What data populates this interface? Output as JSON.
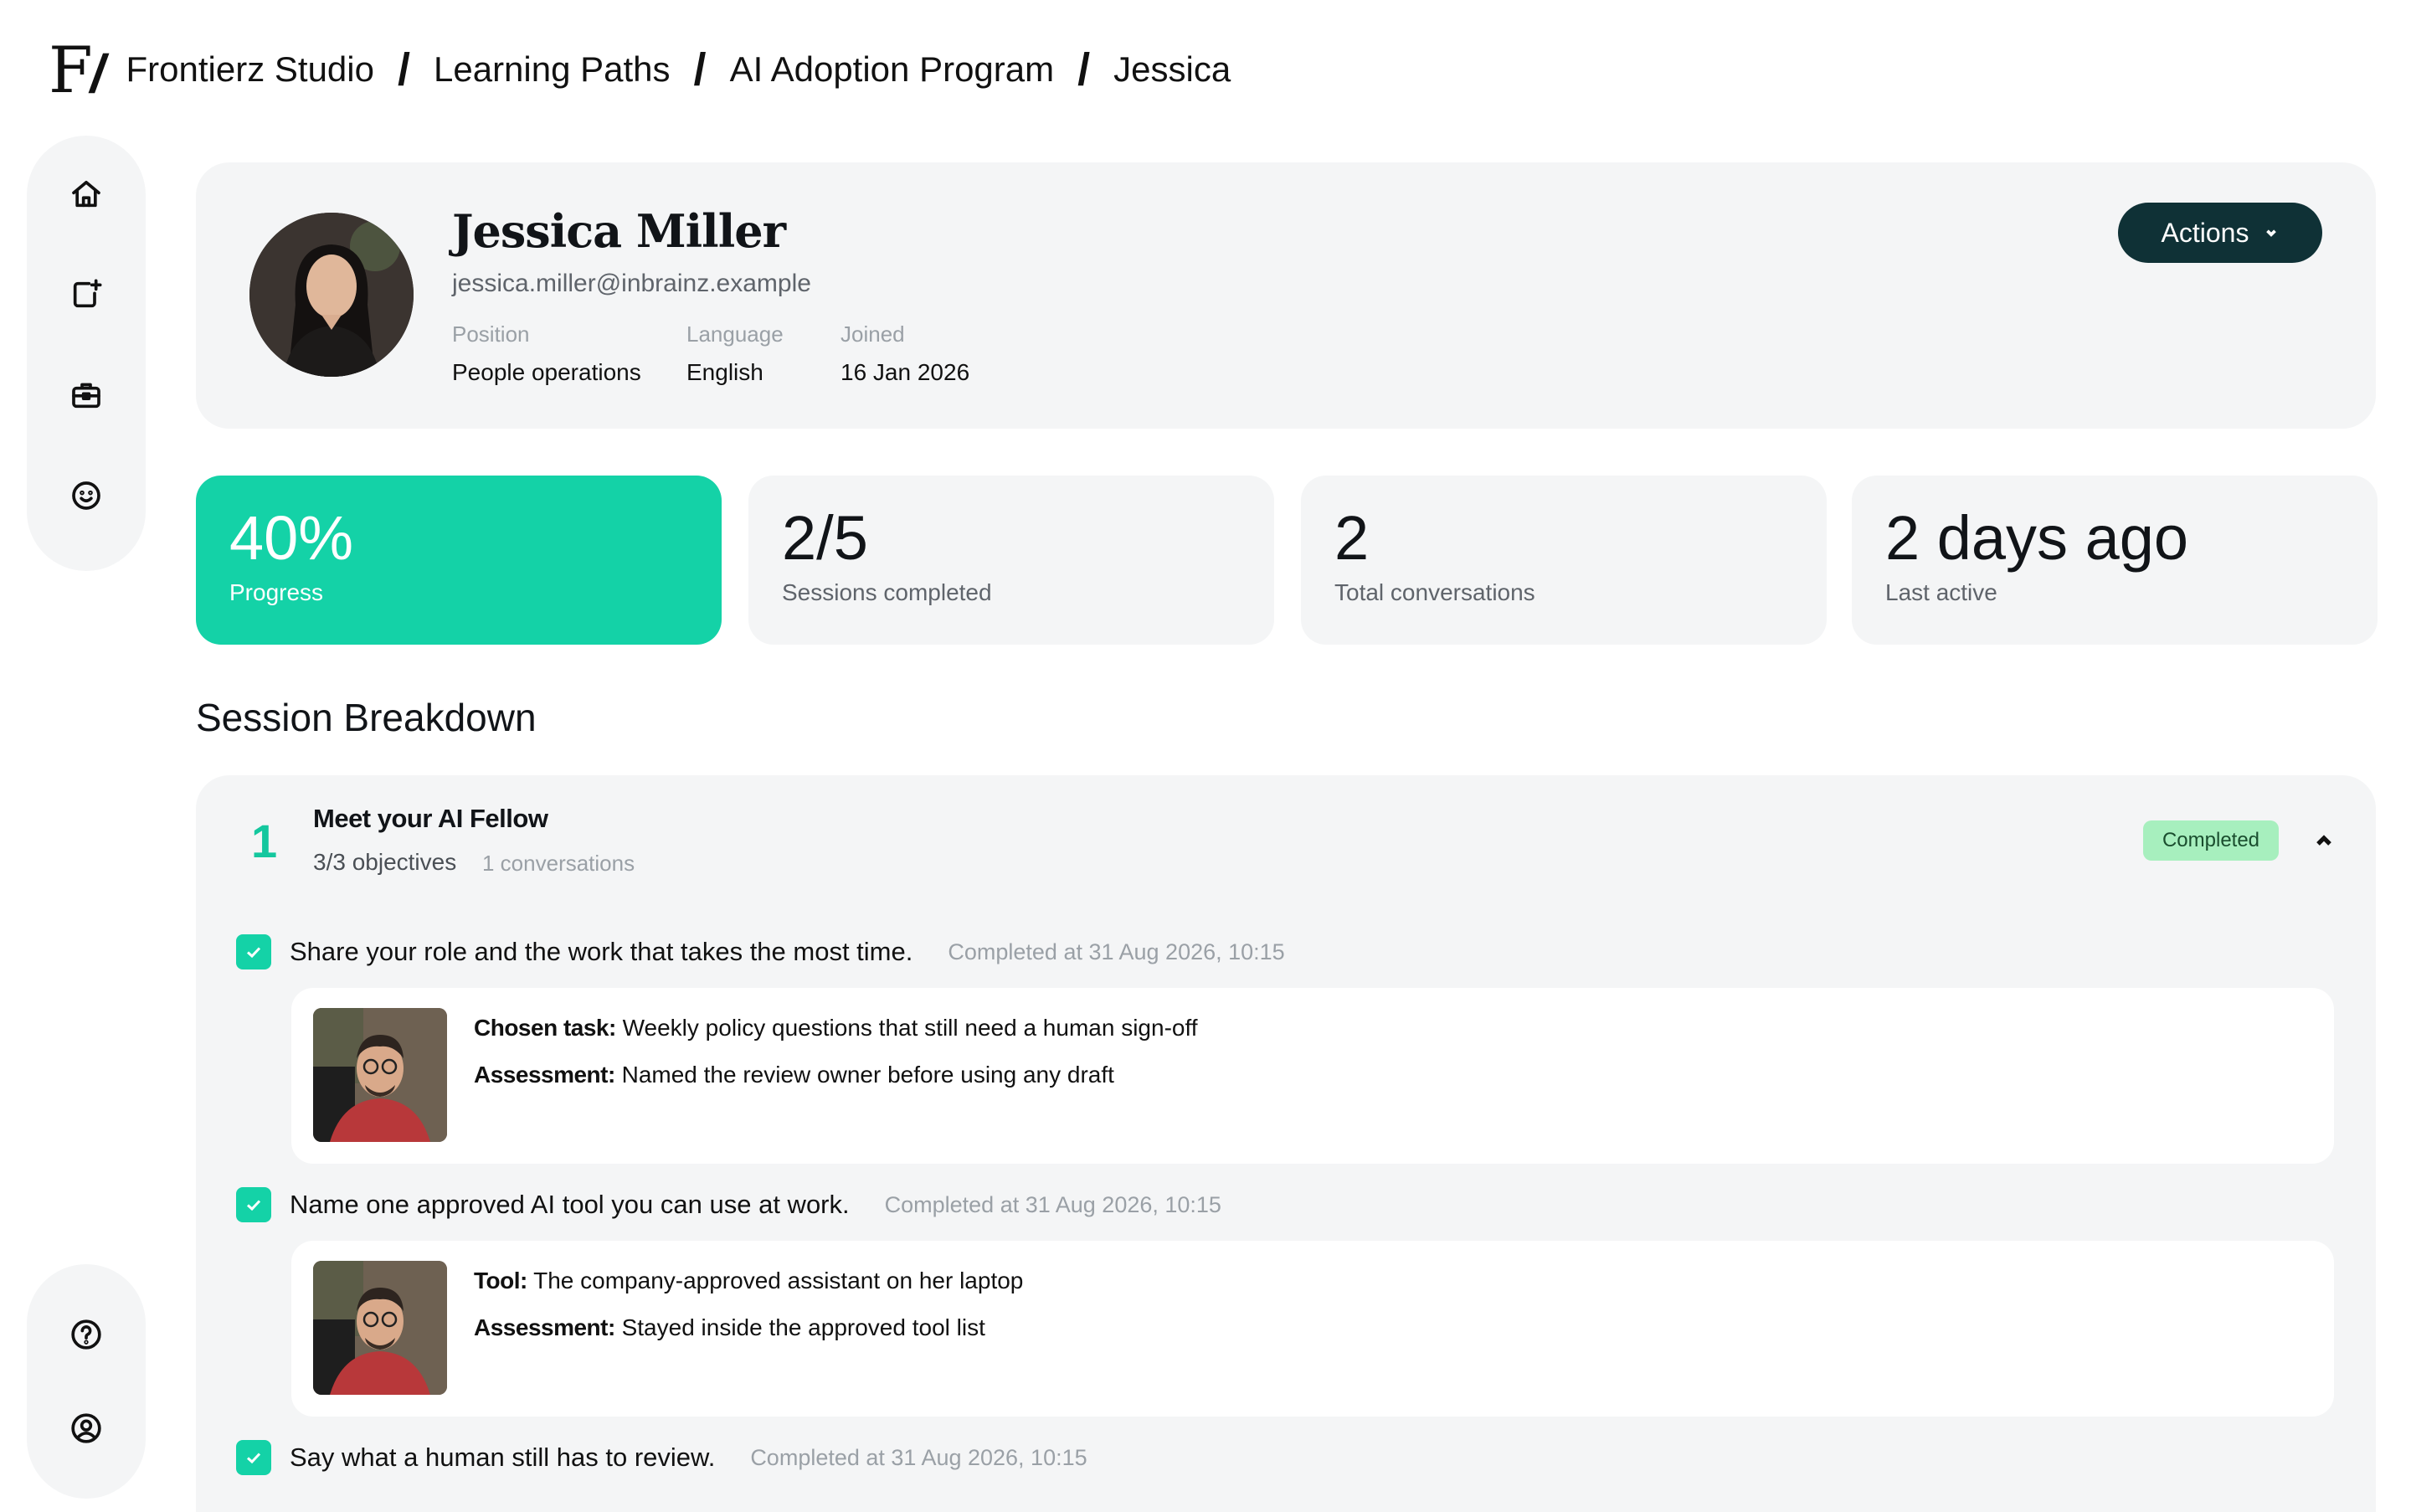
{
  "breadcrumb": {
    "logo": "F",
    "items": [
      "Frontierz Studio",
      "Learning Paths",
      "AI Adoption Program",
      "Jessica"
    ],
    "separator": "/"
  },
  "sidebar": {
    "top_icons": [
      "home-icon",
      "add-session-icon",
      "briefcase-icon",
      "smiley-icon"
    ],
    "bottom_icons": [
      "help-icon",
      "profile-icon"
    ]
  },
  "profile": {
    "name": "Jessica Miller",
    "email": "jessica.miller@inbrainz.example",
    "position_label": "Position",
    "position": "People operations",
    "language_label": "Language",
    "language": "English",
    "joined_label": "Joined",
    "joined": "16 Jan 2026",
    "actions_label": "Actions"
  },
  "stats": [
    {
      "value": "40%",
      "label": "Progress"
    },
    {
      "value": "2/5",
      "label": "Sessions completed"
    },
    {
      "value": "2",
      "label": "Total conversations"
    },
    {
      "value": "2 days ago",
      "label": "Last active"
    }
  ],
  "section_title": "Session Breakdown",
  "session": {
    "number": "1",
    "title": "Meet your AI Fellow",
    "objectives": "3/3 objectives",
    "conversations": "1 conversations",
    "status": "Completed",
    "items": [
      {
        "text": "Share your role and the work that takes the most time.",
        "completed": "Completed at 31 Aug 2026, 10:15",
        "detail": {
          "k1": "Chosen task:",
          "v1": "Weekly policy questions that still need a human sign-off",
          "k2": "Assessment:",
          "v2": "Named the review owner before using any draft"
        }
      },
      {
        "text": "Name one approved AI tool you can use at work.",
        "completed": "Completed at 31 Aug 2026, 10:15",
        "detail": {
          "k1": "Tool:",
          "v1": "The company-approved assistant on her laptop",
          "k2": "Assessment:",
          "v2": "Stayed inside the approved tool list"
        }
      },
      {
        "text": "Say what a human still has to review.",
        "completed": "Completed at 31 Aug 2026, 10:15"
      }
    ]
  },
  "colors": {
    "accent": "#14d2a7",
    "actions_button": "#0f3136",
    "badge": "#a7efbe",
    "card_bg": "#f4f5f6"
  }
}
